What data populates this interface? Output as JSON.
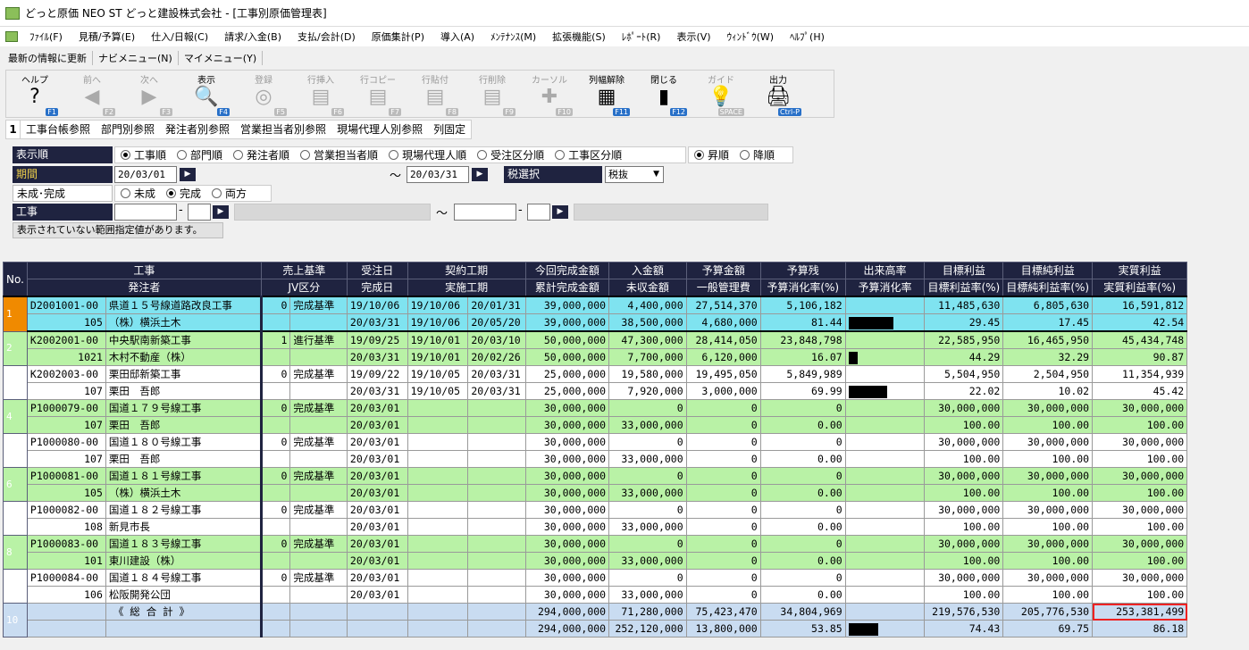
{
  "window": {
    "title": "どっと原価 NEO ST どっと建設株式会社 - [工事別原価管理表]"
  },
  "menu": [
    "ﾌｧｲﾙ(F)",
    "見積/予算(E)",
    "仕入/日報(C)",
    "請求/入金(B)",
    "支払/会計(D)",
    "原価集計(P)",
    "導入(A)",
    "ﾒﾝﾃﾅﾝｽ(M)",
    "拡張機能(S)",
    "ﾚﾎﾟｰﾄ(R)",
    "表示(V)",
    "ｳｨﾝﾄﾞｳ(W)",
    "ﾍﾙﾌﾟ(H)"
  ],
  "menu2": [
    "最新の情報に更新",
    "ナビメニュー(N)",
    "マイメニュー(Y)"
  ],
  "toolbar": [
    {
      "label": "ヘルプ",
      "key": "F1",
      "icon": "?",
      "enabled": true
    },
    {
      "label": "前へ",
      "key": "F2",
      "icon": "◀",
      "enabled": false
    },
    {
      "label": "次へ",
      "key": "F3",
      "icon": "▶",
      "enabled": false
    },
    {
      "label": "表示",
      "key": "F4",
      "icon": "🔍",
      "enabled": true
    },
    {
      "label": "登録",
      "key": "F5",
      "icon": "◎",
      "enabled": false
    },
    {
      "label": "行挿入",
      "key": "F6",
      "icon": "▤",
      "enabled": false
    },
    {
      "label": "行コピー",
      "key": "F7",
      "icon": "▤",
      "enabled": false
    },
    {
      "label": "行貼付",
      "key": "F8",
      "icon": "▤",
      "enabled": false
    },
    {
      "label": "行削除",
      "key": "F9",
      "icon": "▤",
      "enabled": false
    },
    {
      "label": "カーソル",
      "key": "F10",
      "icon": "✚",
      "enabled": false
    },
    {
      "label": "列幅解除",
      "key": "F11",
      "icon": "▦",
      "enabled": true
    },
    {
      "label": "閉じる",
      "key": "F12",
      "icon": "▮",
      "enabled": true
    },
    {
      "label": "ガイド",
      "key": "SPACE",
      "icon": "💡",
      "enabled": false
    },
    {
      "label": "出力",
      "key": "Ctrl-P",
      "icon": "🖨",
      "enabled": true
    }
  ],
  "views": {
    "number": "1",
    "items": [
      "工事台帳参照",
      "部門別参照",
      "発注者別参照",
      "営業担当者別参照",
      "現場代理人別参照",
      "列固定"
    ]
  },
  "filters": {
    "order_label": "表示順",
    "order_options": [
      "工事順",
      "部門順",
      "発注者順",
      "営業担当者順",
      "現場代理人順",
      "受注区分順",
      "工事区分順"
    ],
    "order_selected": "工事順",
    "dir_options": [
      "昇順",
      "降順"
    ],
    "dir_selected": "昇順",
    "period_label": "期間",
    "period_from": "20/03/01",
    "period_to": "20/03/31",
    "tax_label": "税選択",
    "tax_value": "税抜",
    "status_label": "未成･完成",
    "status_options": [
      "未成",
      "完成",
      "両方"
    ],
    "status_selected": "完成",
    "koji_label": "工事",
    "range_sep": "～",
    "dash": "-",
    "notice": "表示されていない範囲指定値があります。"
  },
  "grid": {
    "headers1": [
      "No.",
      "工事",
      "売上基準",
      "受注日",
      "契約工期",
      "今回完成金額",
      "入金額",
      "予算金額",
      "予算残",
      "出来高率",
      "目標利益",
      "目標純利益",
      "実質利益"
    ],
    "headers2": [
      "発注者",
      "JV区分",
      "完成日",
      "実施工期",
      "累計完成金額",
      "未収金額",
      "一般管理費",
      "予算消化率(%)",
      "予算消化率",
      "目標利益率(%)",
      "目標純利益率(%)",
      "実質利益率(%)"
    ],
    "rows": [
      {
        "no": "1",
        "style": "cyan",
        "code": "D2001001-00",
        "name": "県道１５号線道路改良工事",
        "jv": "0",
        "basis": "完成基準",
        "order": "19/10/06",
        "k_from": "19/10/06",
        "k_to": "20/01/31",
        "done": "39,000,000",
        "paid": "4,400,000",
        "budget": "27,514,370",
        "remain": "5,106,182",
        "profit": "11,485,630",
        "net": "6,805,630",
        "real": "16,591,812",
        "client_no": "105",
        "client": "（株）横浜土木",
        "done_date": "20/03/31",
        "j_from": "19/10/06",
        "j_to": "20/05/20",
        "total": "39,000,000",
        "unpaid": "38,500,000",
        "admin": "4,680,000",
        "rate": "81.44",
        "bar": 0.8144,
        "profit_rate": "29.45",
        "net_rate": "17.45",
        "real_rate": "42.54"
      },
      {
        "no": "2",
        "style": "green",
        "code": "K2002001-00",
        "name": "中央駅南新築工事",
        "jv": "1",
        "basis": "進行基準",
        "order": "19/09/25",
        "k_from": "19/10/01",
        "k_to": "20/03/10",
        "done": "50,000,000",
        "paid": "47,300,000",
        "budget": "28,414,050",
        "remain": "23,848,798",
        "profit": "22,585,950",
        "net": "16,465,950",
        "real": "45,434,748",
        "client_no": "1021",
        "client": "木村不動産（株）",
        "done_date": "20/03/31",
        "j_from": "19/10/01",
        "j_to": "20/02/26",
        "total": "50,000,000",
        "unpaid": "7,700,000",
        "admin": "6,120,000",
        "rate": "16.07",
        "bar": 0.1607,
        "profit_rate": "44.29",
        "net_rate": "32.29",
        "real_rate": "90.87"
      },
      {
        "no": "3",
        "style": "white",
        "code": "K2002003-00",
        "name": "栗田邸新築工事",
        "jv": "0",
        "basis": "完成基準",
        "order": "19/09/22",
        "k_from": "19/10/05",
        "k_to": "20/03/31",
        "done": "25,000,000",
        "paid": "19,580,000",
        "budget": "19,495,050",
        "remain": "5,849,989",
        "profit": "5,504,950",
        "net": "2,504,950",
        "real": "11,354,939",
        "client_no": "107",
        "client": "栗田　吾郎",
        "done_date": "20/03/31",
        "j_from": "19/10/05",
        "j_to": "20/03/31",
        "total": "25,000,000",
        "unpaid": "7,920,000",
        "admin": "3,000,000",
        "rate": "69.99",
        "bar": 0.6999,
        "profit_rate": "22.02",
        "net_rate": "10.02",
        "real_rate": "45.42"
      },
      {
        "no": "4",
        "style": "green",
        "code": "P1000079-00",
        "name": "国道１７９号線工事",
        "jv": "0",
        "basis": "完成基準",
        "order": "20/03/01",
        "k_from": "",
        "k_to": "",
        "done": "30,000,000",
        "paid": "0",
        "budget": "0",
        "remain": "0",
        "profit": "30,000,000",
        "net": "30,000,000",
        "real": "30,000,000",
        "client_no": "107",
        "client": "栗田　吾郎",
        "done_date": "20/03/01",
        "j_from": "",
        "j_to": "",
        "total": "30,000,000",
        "unpaid": "33,000,000",
        "admin": "0",
        "rate": "0.00",
        "bar": 0,
        "profit_rate": "100.00",
        "net_rate": "100.00",
        "real_rate": "100.00"
      },
      {
        "no": "5",
        "style": "white",
        "code": "P1000080-00",
        "name": "国道１８０号線工事",
        "jv": "0",
        "basis": "完成基準",
        "order": "20/03/01",
        "k_from": "",
        "k_to": "",
        "done": "30,000,000",
        "paid": "0",
        "budget": "0",
        "remain": "0",
        "profit": "30,000,000",
        "net": "30,000,000",
        "real": "30,000,000",
        "client_no": "107",
        "client": "栗田　吾郎",
        "done_date": "20/03/01",
        "j_from": "",
        "j_to": "",
        "total": "30,000,000",
        "unpaid": "33,000,000",
        "admin": "0",
        "rate": "0.00",
        "bar": 0,
        "profit_rate": "100.00",
        "net_rate": "100.00",
        "real_rate": "100.00"
      },
      {
        "no": "6",
        "style": "green",
        "code": "P1000081-00",
        "name": "国道１８１号線工事",
        "jv": "0",
        "basis": "完成基準",
        "order": "20/03/01",
        "k_from": "",
        "k_to": "",
        "done": "30,000,000",
        "paid": "0",
        "budget": "0",
        "remain": "0",
        "profit": "30,000,000",
        "net": "30,000,000",
        "real": "30,000,000",
        "client_no": "105",
        "client": "（株）横浜土木",
        "done_date": "20/03/01",
        "j_from": "",
        "j_to": "",
        "total": "30,000,000",
        "unpaid": "33,000,000",
        "admin": "0",
        "rate": "0.00",
        "bar": 0,
        "profit_rate": "100.00",
        "net_rate": "100.00",
        "real_rate": "100.00"
      },
      {
        "no": "7",
        "style": "white",
        "code": "P1000082-00",
        "name": "国道１８２号線工事",
        "jv": "0",
        "basis": "完成基準",
        "order": "20/03/01",
        "k_from": "",
        "k_to": "",
        "done": "30,000,000",
        "paid": "0",
        "budget": "0",
        "remain": "0",
        "profit": "30,000,000",
        "net": "30,000,000",
        "real": "30,000,000",
        "client_no": "108",
        "client": "新見市長",
        "done_date": "20/03/01",
        "j_from": "",
        "j_to": "",
        "total": "30,000,000",
        "unpaid": "33,000,000",
        "admin": "0",
        "rate": "0.00",
        "bar": 0,
        "profit_rate": "100.00",
        "net_rate": "100.00",
        "real_rate": "100.00"
      },
      {
        "no": "8",
        "style": "green",
        "code": "P1000083-00",
        "name": "国道１８３号線工事",
        "jv": "0",
        "basis": "完成基準",
        "order": "20/03/01",
        "k_from": "",
        "k_to": "",
        "done": "30,000,000",
        "paid": "0",
        "budget": "0",
        "remain": "0",
        "profit": "30,000,000",
        "net": "30,000,000",
        "real": "30,000,000",
        "client_no": "101",
        "client": "東川建設（株）",
        "done_date": "20/03/01",
        "j_from": "",
        "j_to": "",
        "total": "30,000,000",
        "unpaid": "33,000,000",
        "admin": "0",
        "rate": "0.00",
        "bar": 0,
        "profit_rate": "100.00",
        "net_rate": "100.00",
        "real_rate": "100.00"
      },
      {
        "no": "9",
        "style": "white",
        "code": "P1000084-00",
        "name": "国道１８４号線工事",
        "jv": "0",
        "basis": "完成基準",
        "order": "20/03/01",
        "k_from": "",
        "k_to": "",
        "done": "30,000,000",
        "paid": "0",
        "budget": "0",
        "remain": "0",
        "profit": "30,000,000",
        "net": "30,000,000",
        "real": "30,000,000",
        "client_no": "106",
        "client": "松阪開発公団",
        "done_date": "20/03/01",
        "j_from": "",
        "j_to": "",
        "total": "30,000,000",
        "unpaid": "33,000,000",
        "admin": "0",
        "rate": "0.00",
        "bar": 0,
        "profit_rate": "100.00",
        "net_rate": "100.00",
        "real_rate": "100.00"
      }
    ],
    "total": {
      "no": "10",
      "label": "《 総 合 計 》",
      "done": "294,000,000",
      "paid": "71,280,000",
      "budget": "75,423,470",
      "remain": "34,804,969",
      "profit": "219,576,530",
      "net": "205,776,530",
      "real": "253,381,499",
      "total": "294,000,000",
      "unpaid": "252,120,000",
      "admin": "13,800,000",
      "rate": "53.85",
      "bar": 0.5385,
      "profit_rate": "74.43",
      "net_rate": "69.75",
      "real_rate": "86.18"
    }
  }
}
